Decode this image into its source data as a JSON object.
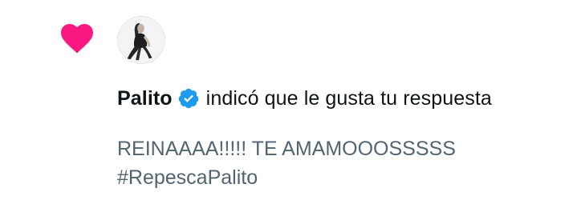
{
  "notification": {
    "icon": "heart-icon",
    "avatar": "avatar-photo",
    "user_name": "Palito",
    "verified_badge": "verified-icon",
    "action_text": "indicó que le gusta tu respuesta",
    "reply_lines": [
      "REINAAAA!!!!! TE AMAMOOOSSSSS",
      "#RepescaPalito"
    ]
  },
  "colors": {
    "heart": "#F91880",
    "verified": "#1D9BF0",
    "primary_text": "#0F1419",
    "secondary_text": "#536471"
  }
}
